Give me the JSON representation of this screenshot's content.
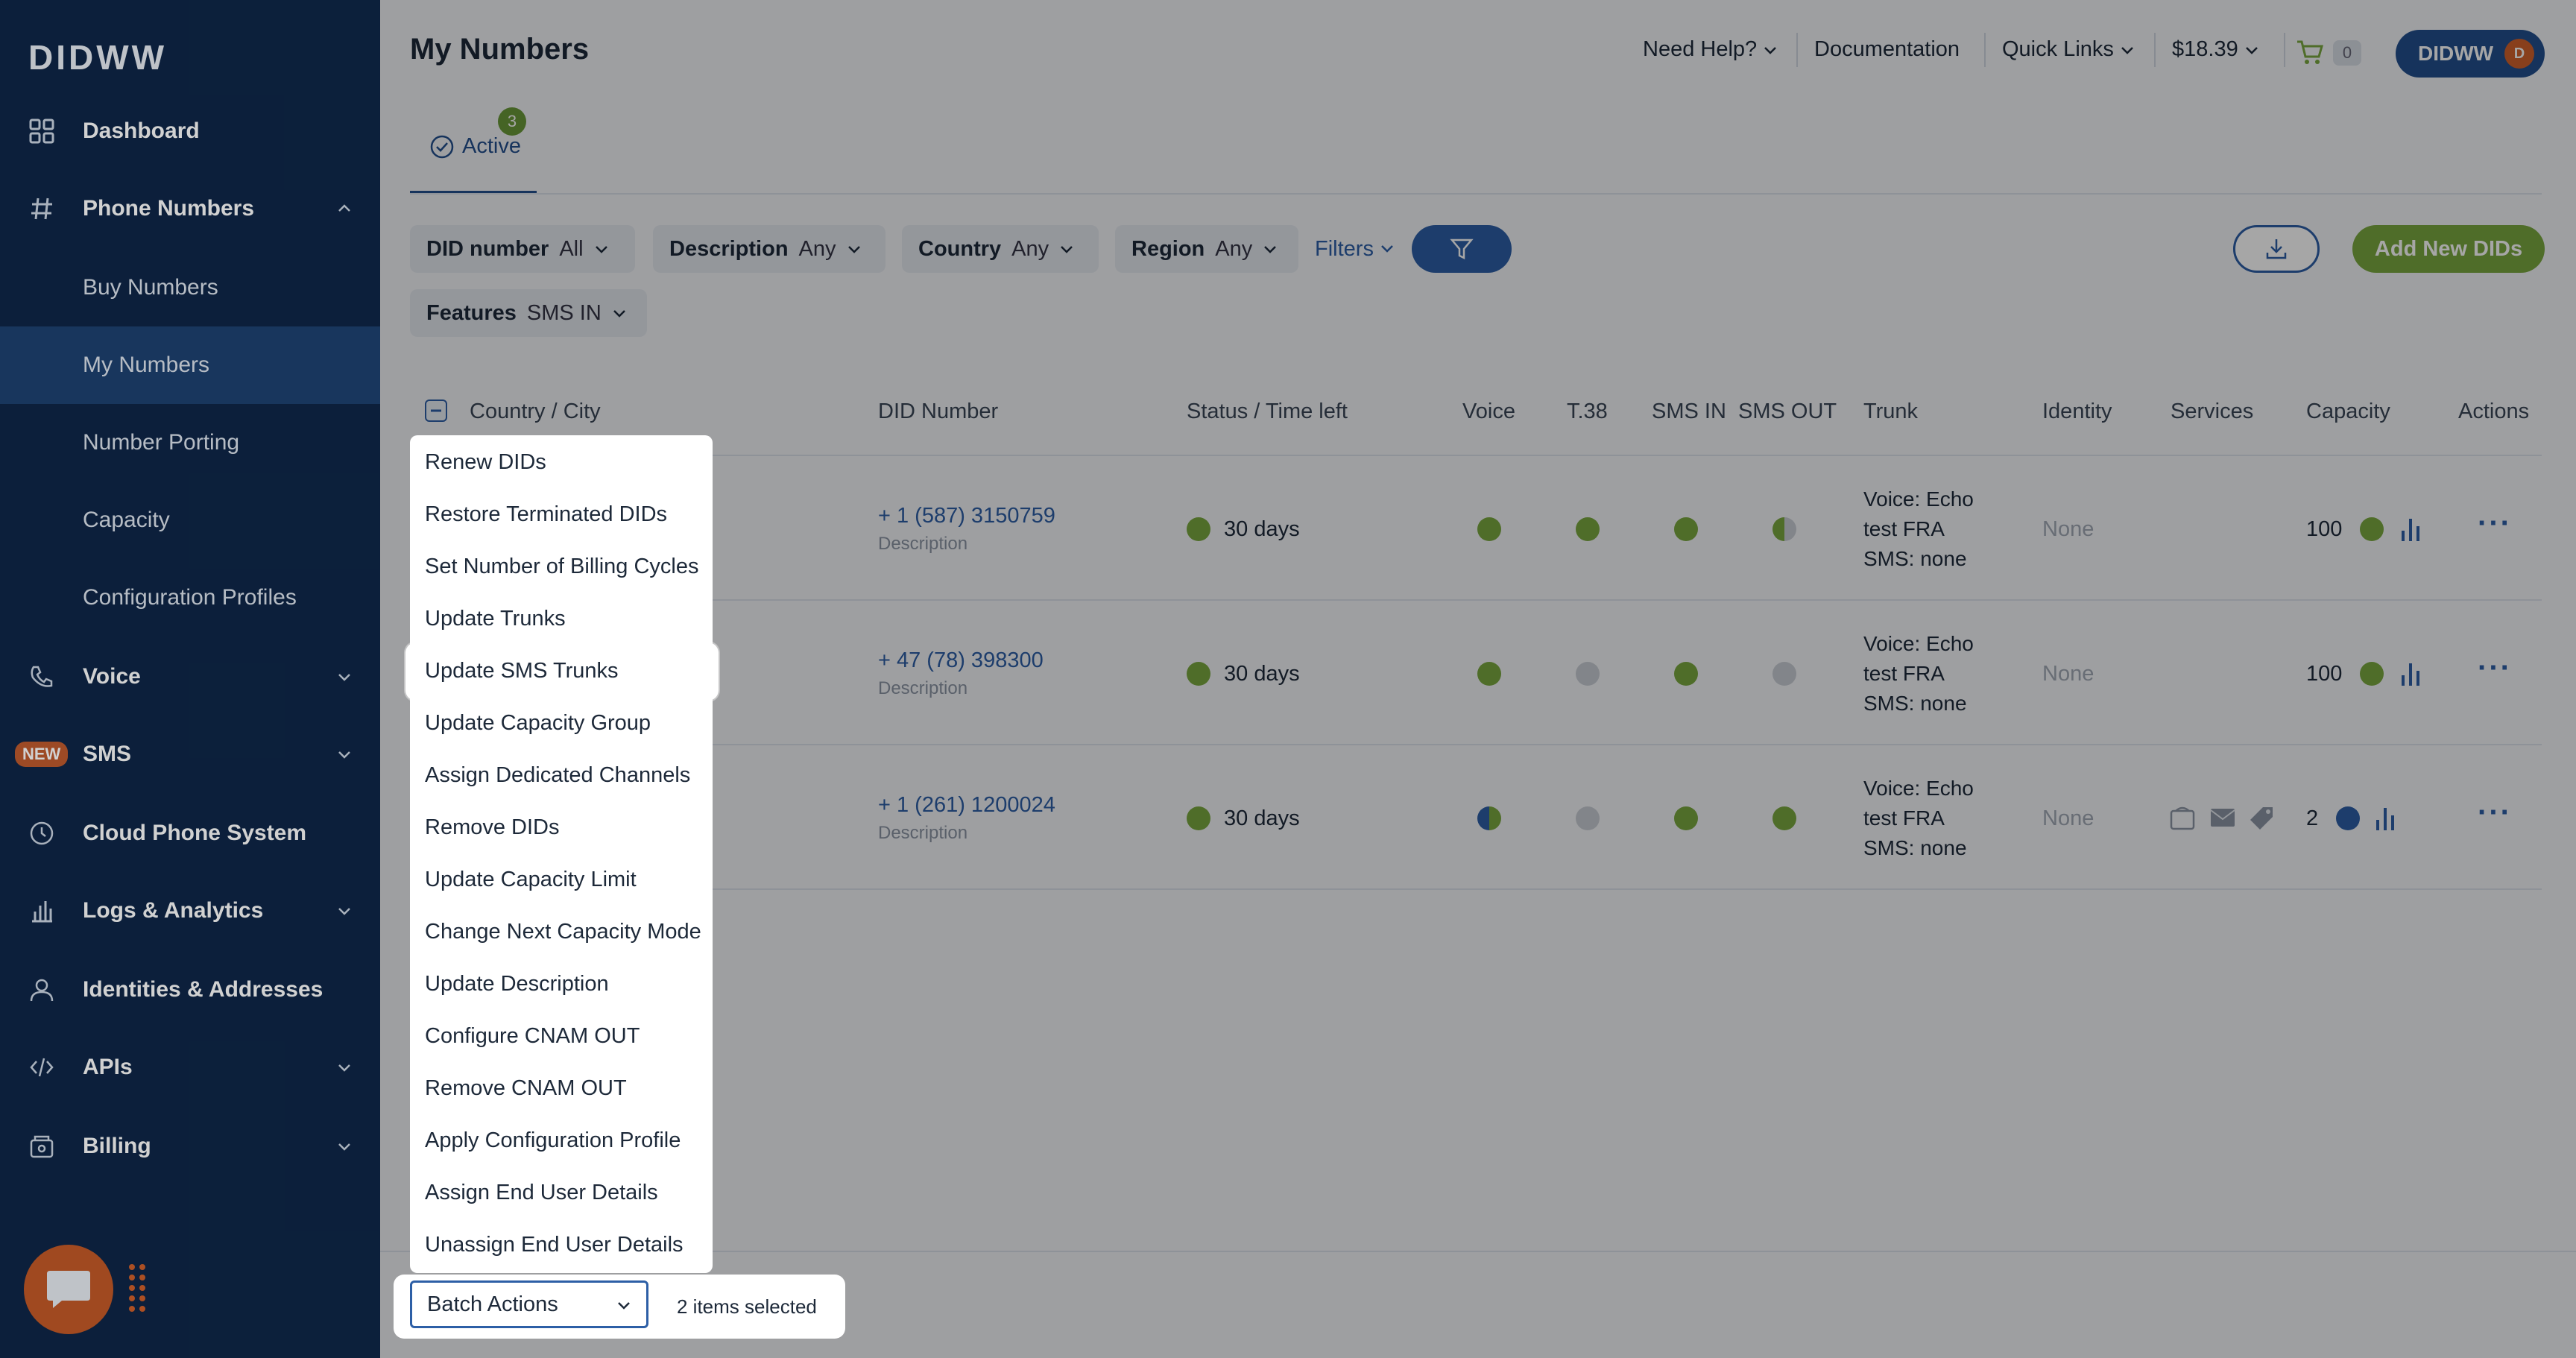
{
  "brand": {
    "logo": "DIDWW"
  },
  "sidebar": {
    "items": [
      {
        "label": "Dashboard",
        "icon": "grid-icon"
      },
      {
        "label": "Phone Numbers",
        "icon": "hash-icon",
        "expanded": true
      },
      {
        "label": "Buy Numbers"
      },
      {
        "label": "My Numbers",
        "active": true
      },
      {
        "label": "Number Porting"
      },
      {
        "label": "Capacity"
      },
      {
        "label": "Configuration Profiles"
      },
      {
        "label": "Voice",
        "icon": "phone-icon"
      },
      {
        "label": "SMS",
        "badge": "NEW"
      },
      {
        "label": "Cloud Phone System",
        "icon": "clock-icon"
      },
      {
        "label": "Logs & Analytics",
        "icon": "bar-chart-icon"
      },
      {
        "label": "Identities & Addresses",
        "icon": "user-icon"
      },
      {
        "label": "APIs",
        "icon": "code-icon"
      },
      {
        "label": "Billing",
        "icon": "wallet-icon"
      }
    ]
  },
  "header": {
    "title": "My Numbers",
    "need_help": "Need Help?",
    "documentation": "Documentation",
    "quick_links": "Quick Links",
    "balance": "$18.39",
    "cart_count": "0",
    "user": "DIDWW",
    "avatar_initial": "D"
  },
  "tabs": {
    "active_label": "Active",
    "active_count": "3"
  },
  "filters": {
    "did_number": {
      "label": "DID number",
      "value": "All"
    },
    "description": {
      "label": "Description",
      "value": "Any"
    },
    "country": {
      "label": "Country",
      "value": "Any"
    },
    "region": {
      "label": "Region",
      "value": "Any"
    },
    "features": {
      "label": "Features",
      "value": "SMS IN"
    },
    "filters_link": "Filters",
    "add_button": "Add New DIDs"
  },
  "table": {
    "headers": [
      "Country / City",
      "DID Number",
      "Status / Time left",
      "Voice",
      "T.38",
      "SMS IN",
      "SMS OUT",
      "Trunk",
      "Identity",
      "Services",
      "Capacity",
      "Actions"
    ],
    "rows": [
      {
        "did": "+ 1 (587) 3150759",
        "desc": "Description",
        "status": "30 days",
        "trunk": [
          "Voice: Echo",
          "test FRA",
          "SMS: none"
        ],
        "identity": "None",
        "capacity": "100"
      },
      {
        "did": "+ 47 (78) 398300",
        "desc": "Description",
        "status": "30 days",
        "trunk": [
          "Voice: Echo",
          "test FRA",
          "SMS: none"
        ],
        "identity": "None",
        "capacity": "100"
      },
      {
        "did": "+ 1 (261) 1200024",
        "desc": "Description",
        "status": "30 days",
        "trunk": [
          "Voice: Echo",
          "test FRA",
          "SMS: none"
        ],
        "identity": "None",
        "capacity": "2"
      }
    ]
  },
  "batch_menu": {
    "items": [
      "Renew DIDs",
      "Restore Terminated DIDs",
      "Set Number of Billing Cycles",
      "Update Trunks",
      "Update SMS Trunks",
      "Update Capacity Group",
      "Assign Dedicated Channels",
      "Remove DIDs",
      "Update Capacity Limit",
      "Change Next Capacity Mode",
      "Update Description",
      "Configure CNAM OUT",
      "Remove CNAM OUT",
      "Apply Configuration Profile",
      "Assign End User Details",
      "Unassign End User Details"
    ],
    "highlighted": "Update SMS Trunks"
  },
  "batch": {
    "select_label": "Batch Actions",
    "selected_text": "2 items selected"
  },
  "colors": {
    "sidebar": "#0f2748",
    "accent": "#2d5fa6",
    "green": "#7aa83f",
    "orange": "#c45a28"
  }
}
